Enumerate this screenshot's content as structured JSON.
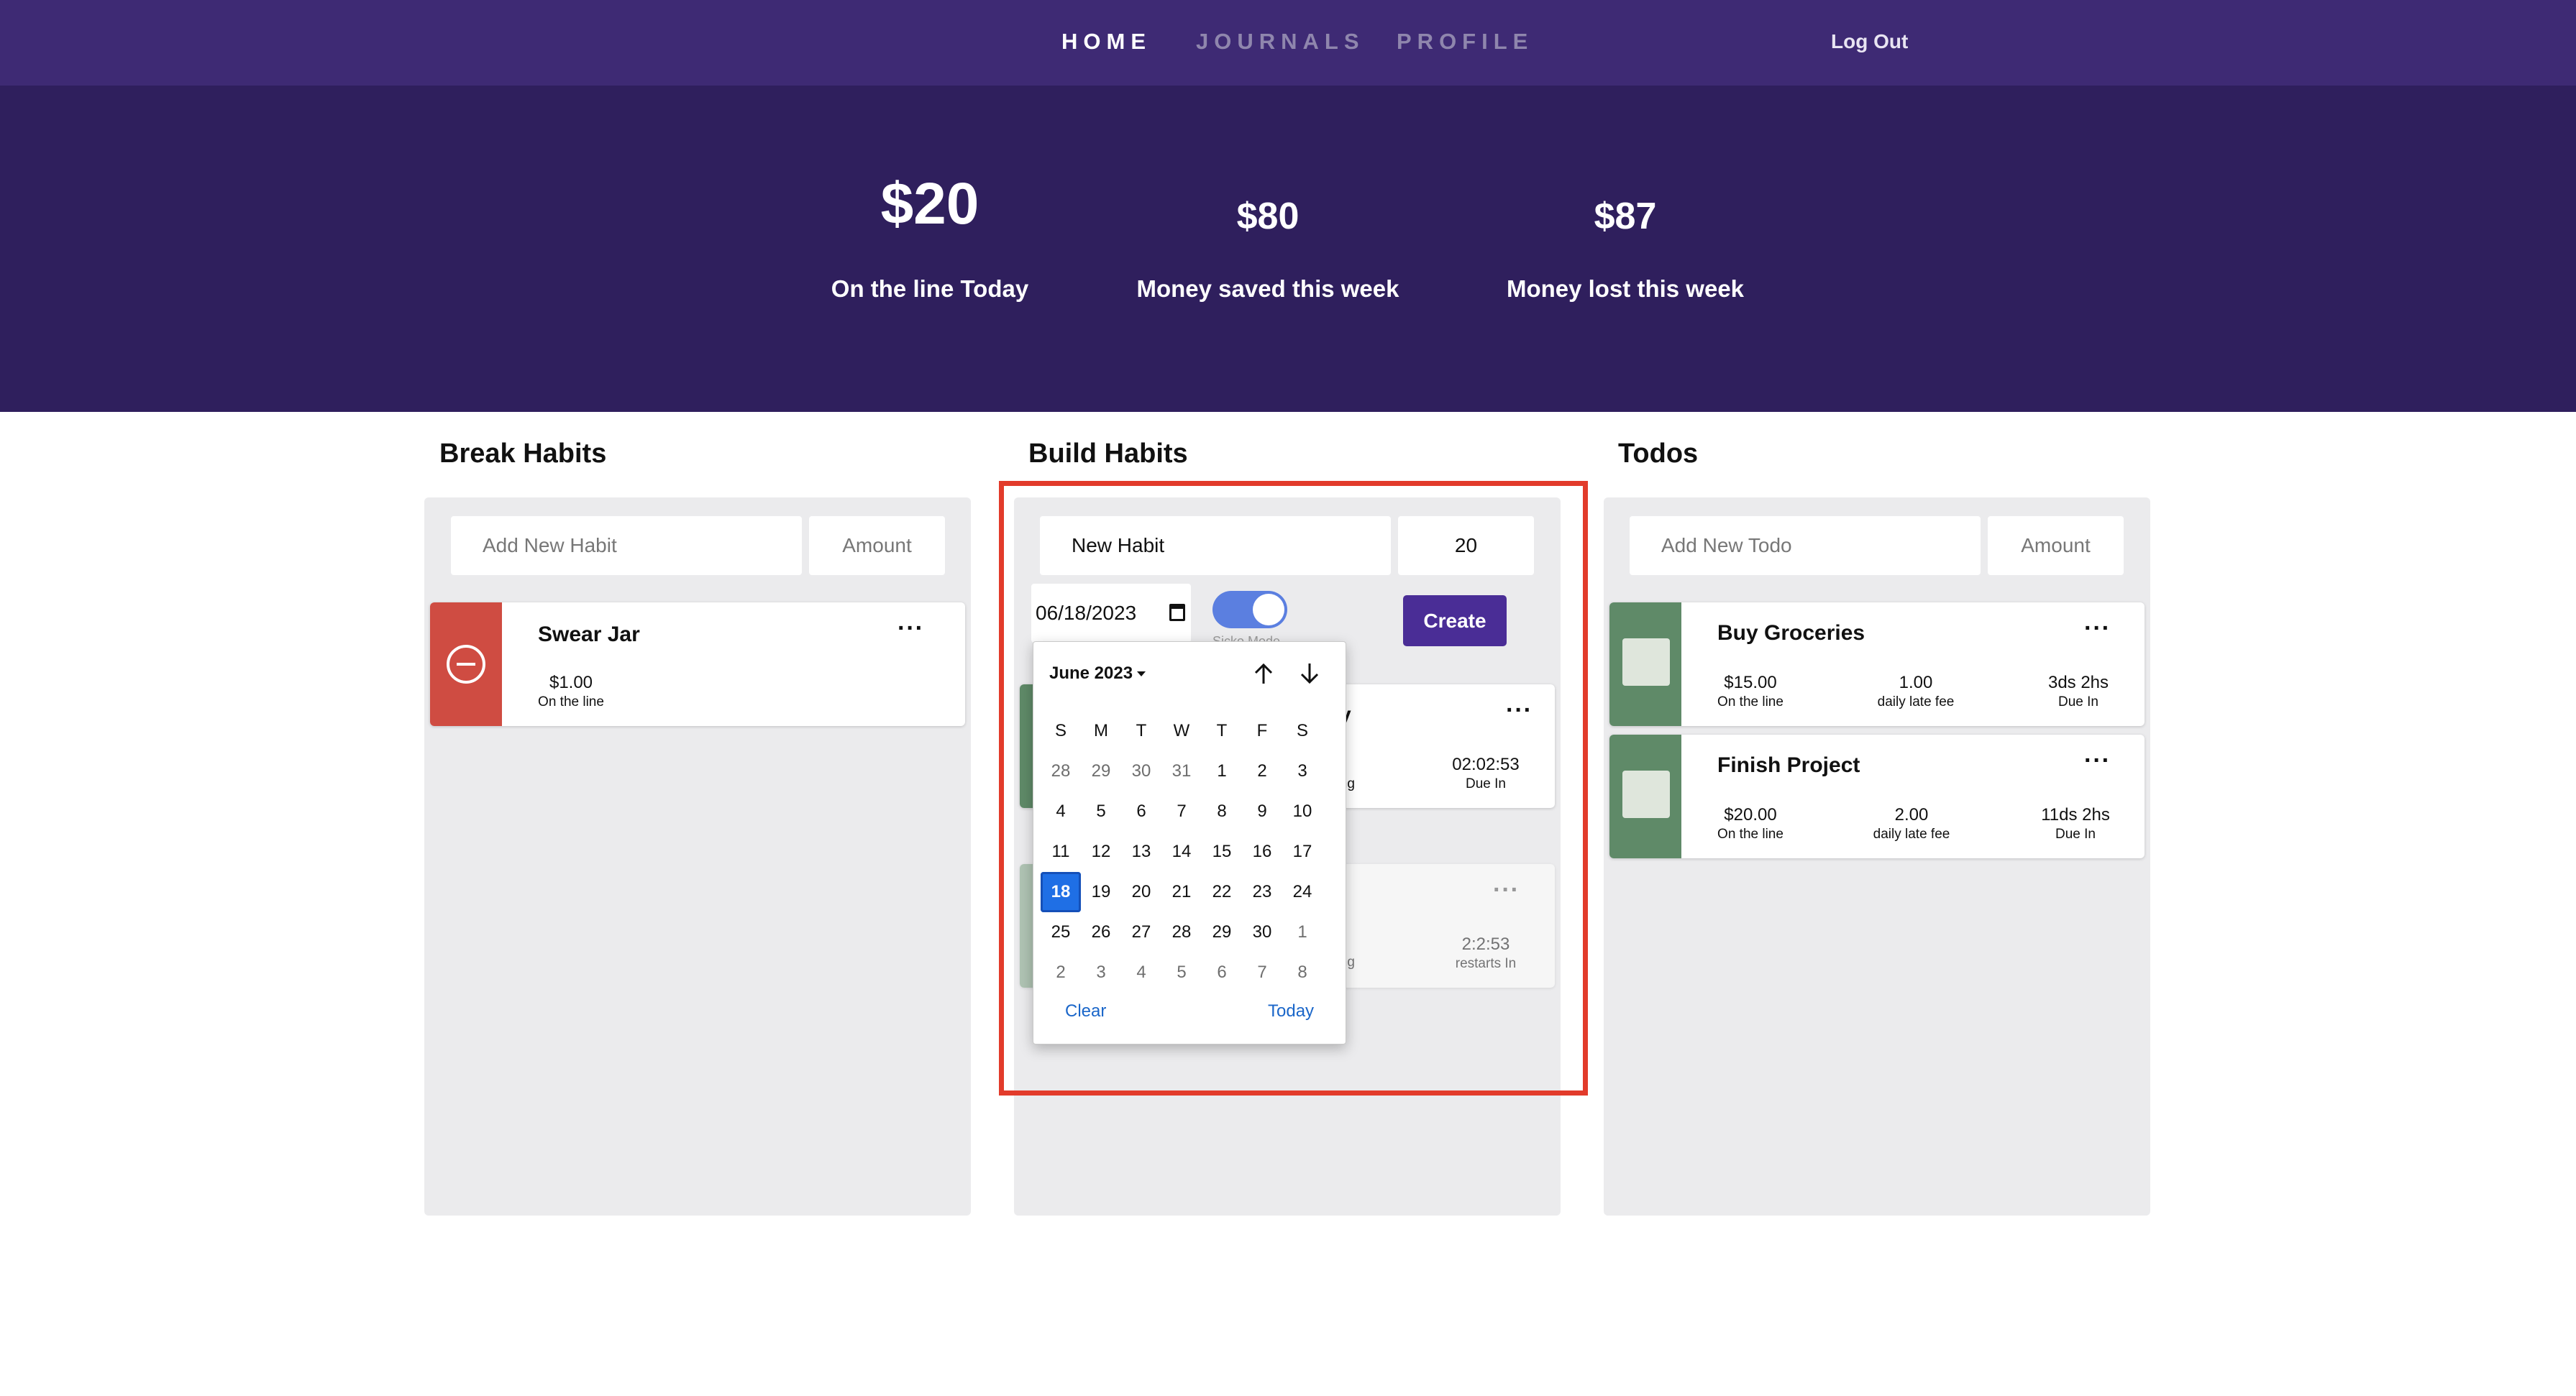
{
  "nav": {
    "home": "HOME",
    "journals": "JOURNALS",
    "profile": "PROFILE",
    "logout": "Log Out"
  },
  "stats": [
    {
      "value": "$20",
      "label": "On the line Today"
    },
    {
      "value": "$80",
      "label": "Money saved this week"
    },
    {
      "value": "$87",
      "label": "Money lost this week"
    }
  ],
  "break_habits": {
    "title": "Break Habits",
    "input_placeholder": "Add New Habit",
    "amount_placeholder": "Amount",
    "items": [
      {
        "name": "Swear Jar",
        "amount": "$1.00",
        "amount_label": "On the line",
        "side_color": "#cf4c42"
      }
    ]
  },
  "build_habits": {
    "title": "Build Habits",
    "name_value": "New Habit",
    "amount_value": "20",
    "date_value": "06/18/2023",
    "toggle_label": "Sicko Mode",
    "create_label": "Create",
    "items": [
      {
        "title_fragment": "y",
        "time": "02:02:53",
        "time_label": "Due In",
        "left_fragment": "ning"
      },
      {
        "title_fragment": "",
        "time": "2:2:53",
        "time_label": "restarts In",
        "left_fragment": "ning"
      }
    ]
  },
  "todos": {
    "title": "Todos",
    "input_placeholder": "Add New Todo",
    "amount_placeholder": "Amount",
    "items": [
      {
        "name": "Buy Groceries",
        "amount": "$15.00",
        "amount_label": "On the line",
        "fee": "1.00",
        "fee_label": "daily late fee",
        "due": "3ds 2hs",
        "due_label": "Due In"
      },
      {
        "name": "Finish Project",
        "amount": "$20.00",
        "amount_label": "On the line",
        "fee": "2.00",
        "fee_label": "daily late fee",
        "due": "11ds 2hs",
        "due_label": "Due In"
      }
    ]
  },
  "calendar": {
    "month": "June 2023",
    "weekdays": [
      "S",
      "M",
      "T",
      "W",
      "T",
      "F",
      "S"
    ],
    "weeks": [
      [
        "28",
        "29",
        "30",
        "31",
        "1",
        "2",
        "3"
      ],
      [
        "4",
        "5",
        "6",
        "7",
        "8",
        "9",
        "10"
      ],
      [
        "11",
        "12",
        "13",
        "14",
        "15",
        "16",
        "17"
      ],
      [
        "18",
        "19",
        "20",
        "21",
        "22",
        "23",
        "24"
      ],
      [
        "25",
        "26",
        "27",
        "28",
        "29",
        "30",
        "1"
      ],
      [
        "2",
        "3",
        "4",
        "5",
        "6",
        "7",
        "8"
      ]
    ],
    "selected": "18",
    "clear": "Clear",
    "today": "Today"
  },
  "colors": {
    "nav_bg": "#3e2a74",
    "hero_bg": "#2f1f5d",
    "accent": "#4a2d96",
    "todo_side": "#5f8a68",
    "break_side": "#cf4c42",
    "highlight": "#e23b2b"
  }
}
